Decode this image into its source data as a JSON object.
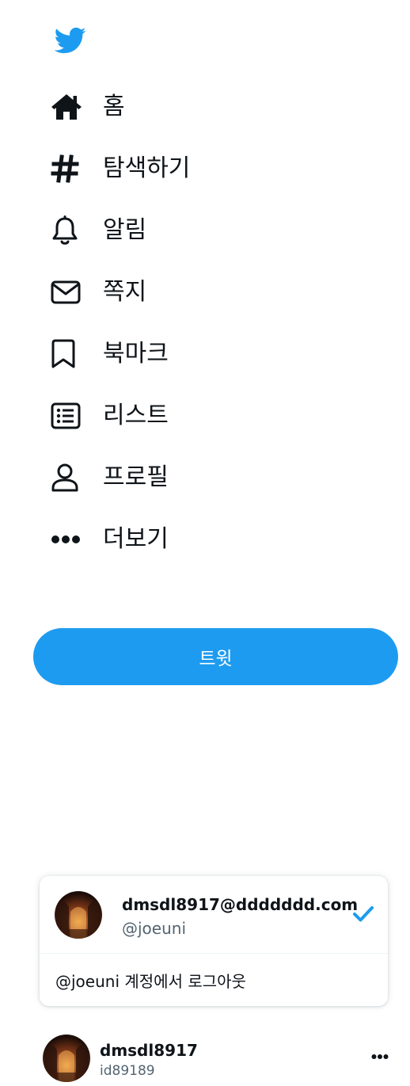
{
  "brand": {
    "logo_icon": "twitter-bird-icon",
    "color": "#1d9bf0"
  },
  "nav": {
    "items": [
      {
        "label": "홈",
        "icon": "home-icon"
      },
      {
        "label": "탐색하기",
        "icon": "hashtag-icon"
      },
      {
        "label": "알림",
        "icon": "bell-icon"
      },
      {
        "label": "쪽지",
        "icon": "mail-icon"
      },
      {
        "label": "북마크",
        "icon": "bookmark-icon"
      },
      {
        "label": "리스트",
        "icon": "list-icon"
      },
      {
        "label": "프로필",
        "icon": "profile-icon"
      },
      {
        "label": "더보기",
        "icon": "more-circles-icon"
      }
    ]
  },
  "tweet_button": {
    "label": "트윗",
    "color": "#1d9bf0"
  },
  "account_card": {
    "email": "dmsdl8917@ddddddd.com",
    "handle": "@joeuni",
    "selected_icon": "checkmark-icon",
    "logout_label": "@joeuni 계정에서 로그아웃"
  },
  "account_switcher": {
    "name": "dmsdl8917",
    "handle": "id89189",
    "more_icon": "ellipsis-icon"
  },
  "colors": {
    "text": "#0f1419",
    "secondary_text": "#536471",
    "accent": "#1d9bf0"
  }
}
